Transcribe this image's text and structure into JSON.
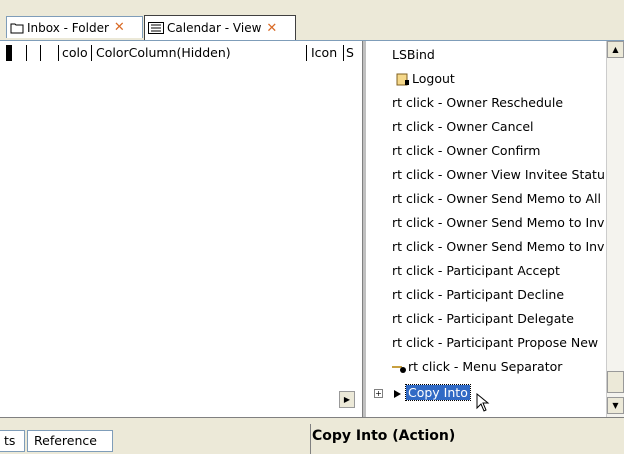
{
  "tabs": [
    {
      "label": "Inbox - Folder"
    },
    {
      "label": "Calendar - View"
    }
  ],
  "columns": {
    "c1": "colo",
    "c2": "ColorColumn(Hidden)",
    "c3": "Icon",
    "c4": "S"
  },
  "tree": {
    "items": [
      {
        "label": "LSBind"
      },
      {
        "label": "Logout"
      },
      {
        "label": "rt click - Owner Reschedule"
      },
      {
        "label": "rt click - Owner Cancel"
      },
      {
        "label": "rt click - Owner Confirm"
      },
      {
        "label": "rt click - Owner View Invitee Statu"
      },
      {
        "label": "rt click - Owner Send Memo to All"
      },
      {
        "label": "rt click - Owner Send Memo to Inv"
      },
      {
        "label": "rt click - Owner Send Memo to Inv"
      },
      {
        "label": "rt click - Participant Accept"
      },
      {
        "label": "rt click - Participant Decline"
      },
      {
        "label": "rt click - Participant Delegate"
      },
      {
        "label": "rt click - Participant Propose New"
      },
      {
        "label": "rt click - Menu Separator"
      },
      {
        "label": "Copy Into"
      }
    ]
  },
  "bottom": {
    "tab_partial": "ts",
    "tab_reference": "Reference",
    "properties_title": "Copy Into (Action)"
  }
}
